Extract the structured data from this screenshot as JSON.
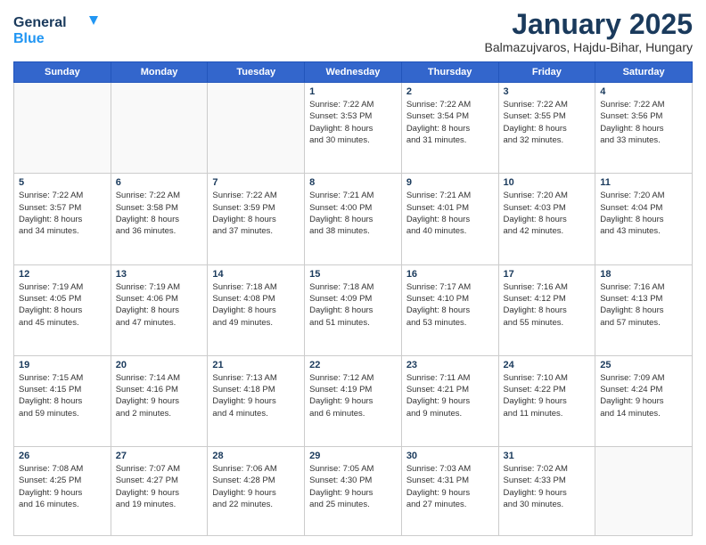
{
  "logo": {
    "general": "General",
    "blue": "Blue"
  },
  "title": "January 2025",
  "subtitle": "Balmazujvaros, Hajdu-Bihar, Hungary",
  "days_of_week": [
    "Sunday",
    "Monday",
    "Tuesday",
    "Wednesday",
    "Thursday",
    "Friday",
    "Saturday"
  ],
  "weeks": [
    [
      {
        "day": "",
        "info": ""
      },
      {
        "day": "",
        "info": ""
      },
      {
        "day": "",
        "info": ""
      },
      {
        "day": "1",
        "info": "Sunrise: 7:22 AM\nSunset: 3:53 PM\nDaylight: 8 hours\nand 30 minutes."
      },
      {
        "day": "2",
        "info": "Sunrise: 7:22 AM\nSunset: 3:54 PM\nDaylight: 8 hours\nand 31 minutes."
      },
      {
        "day": "3",
        "info": "Sunrise: 7:22 AM\nSunset: 3:55 PM\nDaylight: 8 hours\nand 32 minutes."
      },
      {
        "day": "4",
        "info": "Sunrise: 7:22 AM\nSunset: 3:56 PM\nDaylight: 8 hours\nand 33 minutes."
      }
    ],
    [
      {
        "day": "5",
        "info": "Sunrise: 7:22 AM\nSunset: 3:57 PM\nDaylight: 8 hours\nand 34 minutes."
      },
      {
        "day": "6",
        "info": "Sunrise: 7:22 AM\nSunset: 3:58 PM\nDaylight: 8 hours\nand 36 minutes."
      },
      {
        "day": "7",
        "info": "Sunrise: 7:22 AM\nSunset: 3:59 PM\nDaylight: 8 hours\nand 37 minutes."
      },
      {
        "day": "8",
        "info": "Sunrise: 7:21 AM\nSunset: 4:00 PM\nDaylight: 8 hours\nand 38 minutes."
      },
      {
        "day": "9",
        "info": "Sunrise: 7:21 AM\nSunset: 4:01 PM\nDaylight: 8 hours\nand 40 minutes."
      },
      {
        "day": "10",
        "info": "Sunrise: 7:20 AM\nSunset: 4:03 PM\nDaylight: 8 hours\nand 42 minutes."
      },
      {
        "day": "11",
        "info": "Sunrise: 7:20 AM\nSunset: 4:04 PM\nDaylight: 8 hours\nand 43 minutes."
      }
    ],
    [
      {
        "day": "12",
        "info": "Sunrise: 7:19 AM\nSunset: 4:05 PM\nDaylight: 8 hours\nand 45 minutes."
      },
      {
        "day": "13",
        "info": "Sunrise: 7:19 AM\nSunset: 4:06 PM\nDaylight: 8 hours\nand 47 minutes."
      },
      {
        "day": "14",
        "info": "Sunrise: 7:18 AM\nSunset: 4:08 PM\nDaylight: 8 hours\nand 49 minutes."
      },
      {
        "day": "15",
        "info": "Sunrise: 7:18 AM\nSunset: 4:09 PM\nDaylight: 8 hours\nand 51 minutes."
      },
      {
        "day": "16",
        "info": "Sunrise: 7:17 AM\nSunset: 4:10 PM\nDaylight: 8 hours\nand 53 minutes."
      },
      {
        "day": "17",
        "info": "Sunrise: 7:16 AM\nSunset: 4:12 PM\nDaylight: 8 hours\nand 55 minutes."
      },
      {
        "day": "18",
        "info": "Sunrise: 7:16 AM\nSunset: 4:13 PM\nDaylight: 8 hours\nand 57 minutes."
      }
    ],
    [
      {
        "day": "19",
        "info": "Sunrise: 7:15 AM\nSunset: 4:15 PM\nDaylight: 8 hours\nand 59 minutes."
      },
      {
        "day": "20",
        "info": "Sunrise: 7:14 AM\nSunset: 4:16 PM\nDaylight: 9 hours\nand 2 minutes."
      },
      {
        "day": "21",
        "info": "Sunrise: 7:13 AM\nSunset: 4:18 PM\nDaylight: 9 hours\nand 4 minutes."
      },
      {
        "day": "22",
        "info": "Sunrise: 7:12 AM\nSunset: 4:19 PM\nDaylight: 9 hours\nand 6 minutes."
      },
      {
        "day": "23",
        "info": "Sunrise: 7:11 AM\nSunset: 4:21 PM\nDaylight: 9 hours\nand 9 minutes."
      },
      {
        "day": "24",
        "info": "Sunrise: 7:10 AM\nSunset: 4:22 PM\nDaylight: 9 hours\nand 11 minutes."
      },
      {
        "day": "25",
        "info": "Sunrise: 7:09 AM\nSunset: 4:24 PM\nDaylight: 9 hours\nand 14 minutes."
      }
    ],
    [
      {
        "day": "26",
        "info": "Sunrise: 7:08 AM\nSunset: 4:25 PM\nDaylight: 9 hours\nand 16 minutes."
      },
      {
        "day": "27",
        "info": "Sunrise: 7:07 AM\nSunset: 4:27 PM\nDaylight: 9 hours\nand 19 minutes."
      },
      {
        "day": "28",
        "info": "Sunrise: 7:06 AM\nSunset: 4:28 PM\nDaylight: 9 hours\nand 22 minutes."
      },
      {
        "day": "29",
        "info": "Sunrise: 7:05 AM\nSunset: 4:30 PM\nDaylight: 9 hours\nand 25 minutes."
      },
      {
        "day": "30",
        "info": "Sunrise: 7:03 AM\nSunset: 4:31 PM\nDaylight: 9 hours\nand 27 minutes."
      },
      {
        "day": "31",
        "info": "Sunrise: 7:02 AM\nSunset: 4:33 PM\nDaylight: 9 hours\nand 30 minutes."
      },
      {
        "day": "",
        "info": ""
      }
    ]
  ]
}
